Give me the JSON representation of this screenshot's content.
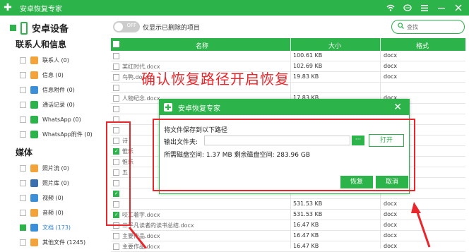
{
  "app": {
    "title": "安卓恢复专家"
  },
  "sidebar": {
    "device_label": "安卓设备",
    "sections": [
      {
        "heading": "联系人和信息",
        "items": [
          {
            "label": "联系人 (0)",
            "icon": "contacts-icon",
            "color": "#f2a33a"
          },
          {
            "label": "信息 (0)",
            "icon": "message-icon",
            "color": "#f2a33a"
          },
          {
            "label": "信息附件 (0)",
            "icon": "attachment-icon",
            "color": "#3a8fd8"
          },
          {
            "label": "通话记录 (0)",
            "icon": "phone-icon",
            "color": "#2cb34a"
          },
          {
            "label": "WhatsApp (0)",
            "icon": "whatsapp-icon",
            "color": "#2cb34a"
          },
          {
            "label": "WhatsApp附件 (0)",
            "icon": "whatsapp-attachment-icon",
            "color": "#2cb34a"
          }
        ]
      },
      {
        "heading": "媒体",
        "items": [
          {
            "label": "照片流 (0)",
            "icon": "photo-stream-icon",
            "color": "#f2a33a"
          },
          {
            "label": "照片库 (0)",
            "icon": "photo-library-icon",
            "color": "#3a6fb0"
          },
          {
            "label": "视频 (0)",
            "icon": "video-icon",
            "color": "#3a8fd8"
          },
          {
            "label": "音频 (0)",
            "icon": "audio-icon",
            "color": "#f2a33a"
          },
          {
            "label": "文档 (173)",
            "icon": "document-icon",
            "color": "#3a8fd8"
          },
          {
            "label": "其他文件 (1245)",
            "icon": "other-files-icon",
            "color": "#f2a33a"
          }
        ]
      }
    ]
  },
  "toolbar": {
    "toggle_state": "OFF",
    "toggle_label": "仅显示已删除的项目",
    "search_placeholder": "查找"
  },
  "table": {
    "headers": [
      "名称",
      "大小",
      "格式"
    ],
    "rows": [
      {
        "name": "",
        "size": "100.61 KB",
        "format": "docx",
        "checked": false
      },
      {
        "name": "某红时代.docx",
        "size": "102.69 KB",
        "format": "docx",
        "checked": false
      },
      {
        "name": "鸟鸭.docx",
        "size": "19.83 KB",
        "format": "docx",
        "checked": false
      },
      {
        "name": "",
        "size": "",
        "format": "",
        "checked": false
      },
      {
        "name": "人物纪念.docx",
        "size": "17.83 KB",
        "format": "docx",
        "checked": false
      },
      {
        "name": "",
        "size": "",
        "format": "",
        "checked": false
      },
      {
        "name": "",
        "size": "",
        "format": "",
        "checked": false
      },
      {
        "name": "",
        "size": "",
        "format": "",
        "checked": false
      },
      {
        "name": "诗",
        "size": "",
        "format": "",
        "checked": false
      },
      {
        "name": "惟乐",
        "size": "",
        "format": "",
        "checked": true
      },
      {
        "name": "惟乐",
        "size": "",
        "format": "",
        "checked": false
      },
      {
        "name": "五",
        "size": "",
        "format": "",
        "checked": false
      },
      {
        "name": "",
        "size": "",
        "format": "",
        "checked": false
      },
      {
        "name": "",
        "size": "",
        "format": "",
        "checked": true
      },
      {
        "name": "",
        "size": "531.53 KB",
        "format": "docx",
        "checked": false
      },
      {
        "name": "咬工著字.docx",
        "size": "531.53 KB",
        "format": "docx",
        "checked": true
      },
      {
        "name": "三平凡读者的读书总结.docx",
        "size": "16.47 KB",
        "format": "docx",
        "checked": false
      },
      {
        "name": "主要作品.docx",
        "size": "16.47 KB",
        "format": "docx",
        "checked": false
      },
      {
        "name": "主要作品.docx",
        "size": "16.47 KB",
        "format": "docx",
        "checked": false
      }
    ]
  },
  "annotation": {
    "text": "确认恢复路径开启恢复"
  },
  "dialog": {
    "title": "安卓恢复专家",
    "heading": "将文件保存到以下路径",
    "output_label": "输出文件夹:",
    "path_value": "",
    "browse_label": "···",
    "open_label": "打开",
    "space_line": "所需磁盘空间:  1.37 MB  剩余磁盘空间:  283.96 GB",
    "recover_label": "恢复",
    "cancel_label": "取消"
  },
  "colors": {
    "accent": "#2cb34a",
    "annotation": "#e8262b"
  }
}
